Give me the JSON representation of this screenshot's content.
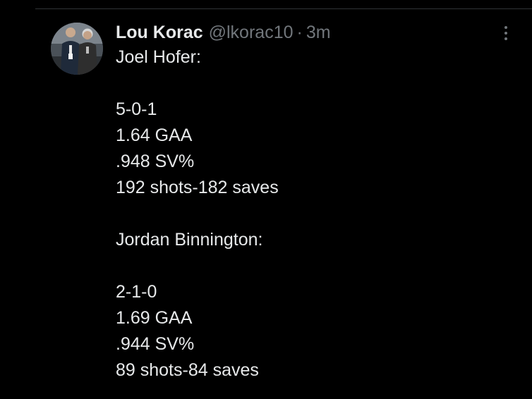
{
  "tweet": {
    "author": {
      "display_name": "Lou Korac",
      "handle": "@lkorac10",
      "separator": "·",
      "time": "3m",
      "avatar_icon": "avatar-photo"
    },
    "more_icon": "more-options-icon",
    "lines": [
      "Joel Hofer:",
      "",
      "5-0-1",
      "1.64 GAA",
      ".948 SV%",
      "192 shots-182 saves",
      "",
      "Jordan Binnington:",
      "",
      "2-1-0",
      "1.69 GAA",
      ".944 SV%",
      "89 shots-84 saves"
    ]
  },
  "colors": {
    "background": "#000000",
    "text_primary": "#e7e9ea",
    "text_secondary": "#71767b",
    "divider": "#2f3336"
  }
}
